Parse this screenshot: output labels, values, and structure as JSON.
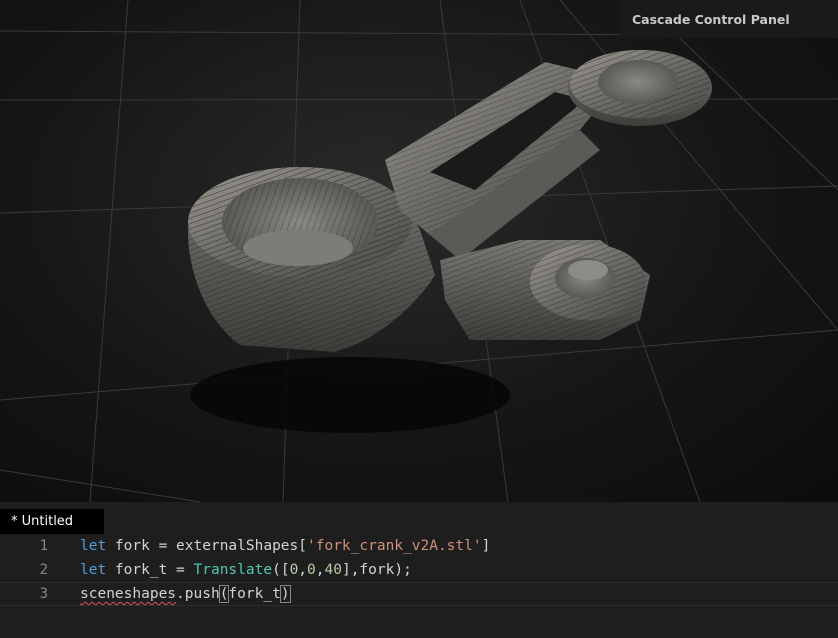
{
  "viewport": {
    "label": "3D viewport",
    "model_icon": "fork-crank-3d-model"
  },
  "control_panel": {
    "title": "Cascade Control Panel"
  },
  "editor": {
    "tab_label": "* Untitled",
    "lines": [
      {
        "number": "1",
        "tokens": [
          {
            "text": "let",
            "kind": "kw"
          },
          {
            "text": " fork = externalShapes[",
            "kind": "ident"
          },
          {
            "text": "'fork_crank_v2A.stl'",
            "kind": "str"
          },
          {
            "text": "]",
            "kind": "ident"
          }
        ]
      },
      {
        "number": "2",
        "tokens": [
          {
            "text": "let",
            "kind": "kw"
          },
          {
            "text": " fork_t = ",
            "kind": "ident"
          },
          {
            "text": "Translate",
            "kind": "fn"
          },
          {
            "text": "([",
            "kind": "ident"
          },
          {
            "text": "0",
            "kind": "num"
          },
          {
            "text": ",",
            "kind": "ident"
          },
          {
            "text": "0",
            "kind": "num"
          },
          {
            "text": ",",
            "kind": "ident"
          },
          {
            "text": "40",
            "kind": "num"
          },
          {
            "text": "],fork);",
            "kind": "ident"
          }
        ]
      },
      {
        "number": "3",
        "tokens": [
          {
            "text": "sceneshapes",
            "kind": "squiggle"
          },
          {
            "text": ".push",
            "kind": "ident"
          },
          {
            "text": "(",
            "kind": "bracket"
          },
          {
            "text": "fork_t",
            "kind": "ident"
          },
          {
            "text": ")",
            "kind": "bracket"
          }
        ]
      }
    ]
  },
  "colors": {
    "keyword": "#569cd6",
    "function": "#4ec9b0",
    "string": "#ce9178",
    "number": "#b5cea8",
    "identifier": "#d4d4d4",
    "error_squiggle": "#e05252"
  }
}
